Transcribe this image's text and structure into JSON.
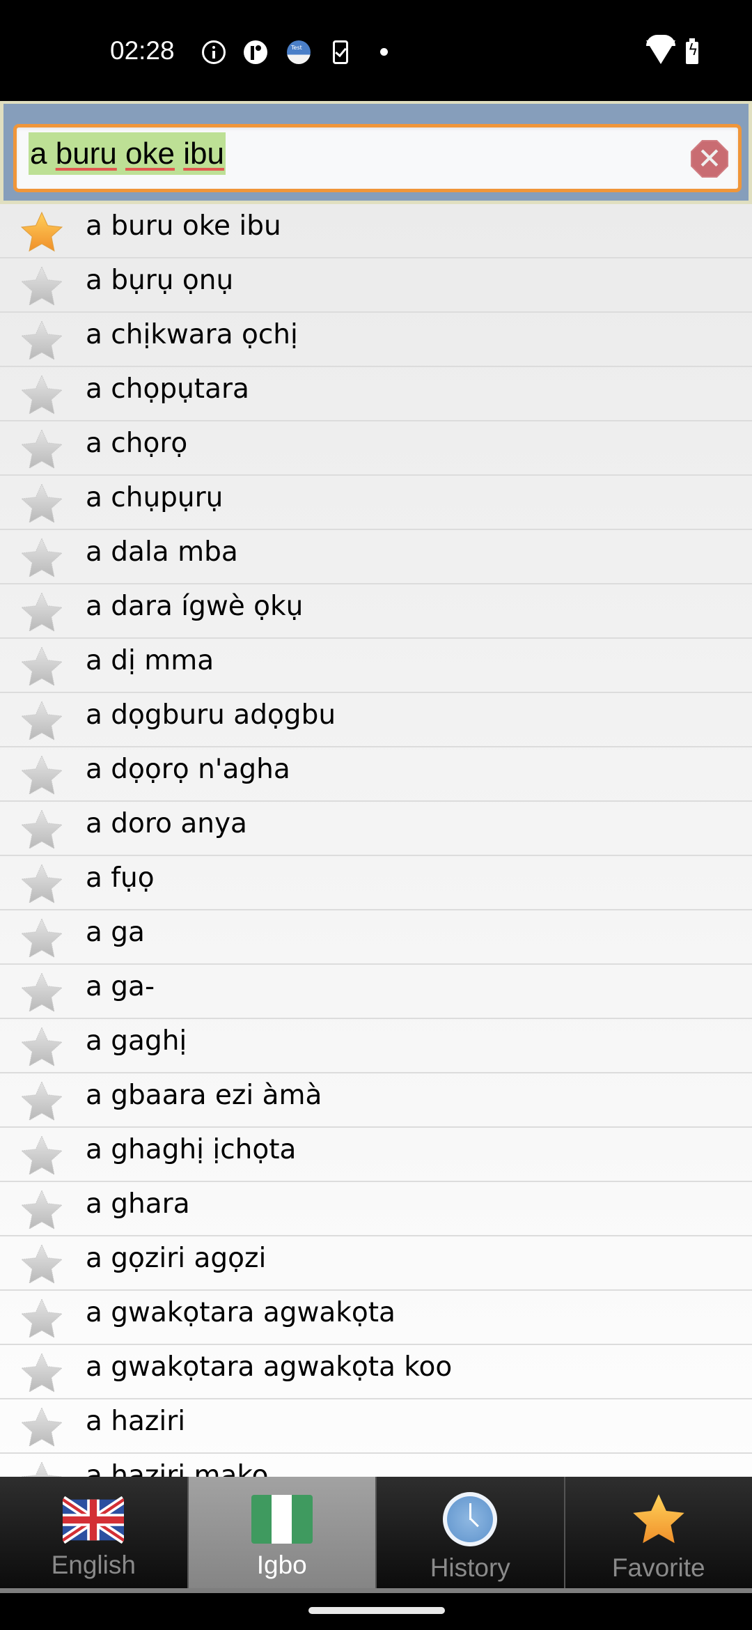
{
  "status_bar": {
    "time": "02:28",
    "notification_icons": [
      "info-icon",
      "p-app-icon",
      "test-app-icon",
      "phone-check-icon",
      "dot-icon"
    ],
    "system_icons": [
      "wifi-icon",
      "battery-charging-icon"
    ],
    "test_icon_label": "Test"
  },
  "search": {
    "query_words": [
      "a",
      "buru",
      "oke",
      "ibu"
    ],
    "query": "a buru oke ibu",
    "clear_icon": "clear-icon",
    "accent_color": "#f0963a",
    "highlight_color": "#bde095"
  },
  "word_list": {
    "items": [
      {
        "word": "a buru oke ibu",
        "favorite": true
      },
      {
        "word": "a bụrụ ọnụ",
        "favorite": false
      },
      {
        "word": "a chịkwara ọchị",
        "favorite": false
      },
      {
        "word": "a chọpụtara",
        "favorite": false
      },
      {
        "word": "a chọrọ",
        "favorite": false
      },
      {
        "word": "a chụpụrụ",
        "favorite": false
      },
      {
        "word": "a dala mba",
        "favorite": false
      },
      {
        "word": "a dara ígwè ọkụ",
        "favorite": false
      },
      {
        "word": "a dị mma",
        "favorite": false
      },
      {
        "word": "a dọgburu adọgbu",
        "favorite": false
      },
      {
        "word": "a dọọrọ n'agha",
        "favorite": false
      },
      {
        "word": "a doro anya",
        "favorite": false
      },
      {
        "word": "a fụọ",
        "favorite": false
      },
      {
        "word": "a ga",
        "favorite": false
      },
      {
        "word": "a ga-",
        "favorite": false
      },
      {
        "word": "a gaghị",
        "favorite": false
      },
      {
        "word": "a gbaara ezi àmà",
        "favorite": false
      },
      {
        "word": "a ghaghị ịchọta",
        "favorite": false
      },
      {
        "word": "a ghara",
        "favorite": false
      },
      {
        "word": "a gọziri agọzi",
        "favorite": false
      },
      {
        "word": "a gwakọtara agwakọta",
        "favorite": false
      },
      {
        "word": "a gwakọtara agwakọta koo",
        "favorite": false
      },
      {
        "word": "a haziri",
        "favorite": false
      },
      {
        "word": "a haziri mako",
        "favorite": false
      }
    ]
  },
  "tabs": [
    {
      "label": "English",
      "icon": "uk-flag-icon",
      "active": false
    },
    {
      "label": "Igbo",
      "icon": "nigeria-flag-icon",
      "active": true
    },
    {
      "label": "History",
      "icon": "clock-icon",
      "active": false
    },
    {
      "label": "Favorite",
      "icon": "star-icon",
      "active": false
    }
  ]
}
